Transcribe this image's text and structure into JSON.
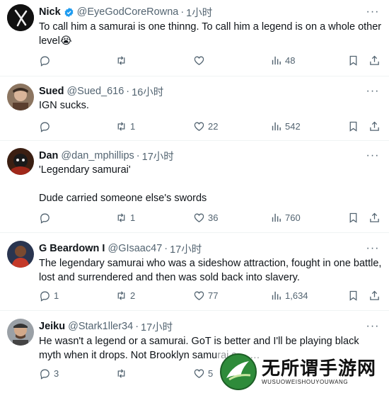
{
  "colors": {
    "text": "#0f1419",
    "muted": "#536471",
    "verified": "#1d9bf0",
    "divider": "#eff3f4"
  },
  "tweets": [
    {
      "name": "Nick",
      "verified": true,
      "handle": "@EyeGodCoreRowna",
      "time": "1小时",
      "text": [
        "To call him a samurai is one thinng. To call him a legend is on a whole other level😭"
      ],
      "replies": "",
      "reposts": "",
      "likes": "",
      "views": "48"
    },
    {
      "name": "Sued",
      "verified": false,
      "handle": "@Sued_616",
      "time": "16小时",
      "text": [
        "IGN sucks."
      ],
      "replies": "",
      "reposts": "1",
      "likes": "22",
      "views": "542"
    },
    {
      "name": "Dan",
      "verified": false,
      "handle": "@dan_mphillips",
      "time": "17小时",
      "text": [
        "'Legendary samurai'",
        "",
        "Dude carried someone else's swords"
      ],
      "replies": "",
      "reposts": "1",
      "likes": "36",
      "views": "760"
    },
    {
      "name": "G Beardown I",
      "verified": false,
      "handle": "@GIsaac47",
      "time": "17小时",
      "text": [
        "The legendary samurai who was a sideshow attraction, fought in one battle, lost and surrendered and then was sold back into slavery."
      ],
      "replies": "1",
      "reposts": "2",
      "likes": "77",
      "views": "1,634"
    },
    {
      "name": "Jeiku",
      "verified": false,
      "handle": "@Stark1ller34",
      "time": "17小时",
      "text": [
        "He wasn't a legend or a samurai. GoT is better and I'll be playing black myth when it drops. Not Brooklyn samurai s… …"
      ],
      "replies": "3",
      "reposts": "",
      "likes": "5",
      "views": ""
    }
  ],
  "watermark": {
    "cn": "无所谓手游网",
    "en": "WUSUOWEISHOUYOUWANG"
  }
}
